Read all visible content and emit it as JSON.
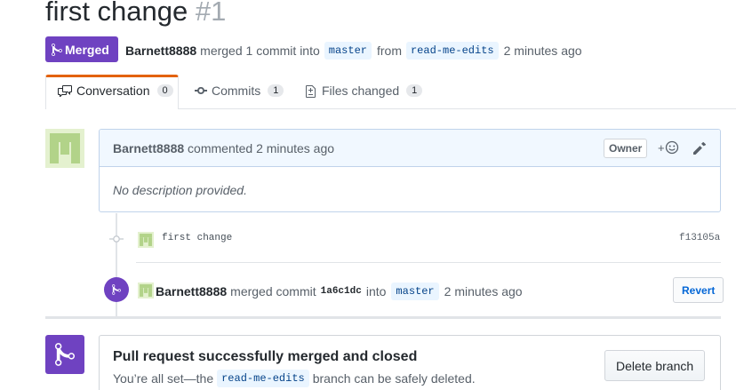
{
  "pr": {
    "title": "first change",
    "number": "#1",
    "state": "Merged",
    "author": "Barnett8888",
    "merged_text": "merged 1 commit into",
    "base_branch": "master",
    "from_text": "from",
    "head_branch": "read-me-edits",
    "time": "2 minutes ago"
  },
  "tabs": [
    {
      "label": "Conversation",
      "count": "0",
      "icon": "comment-discussion-icon"
    },
    {
      "label": "Commits",
      "count": "1",
      "icon": "git-commit-icon"
    },
    {
      "label": "Files changed",
      "count": "1",
      "icon": "file-diff-icon"
    }
  ],
  "comment": {
    "author": "Barnett8888",
    "action": "commented 2 minutes ago",
    "badge": "Owner",
    "reaction_label": "+",
    "body": "No description provided."
  },
  "commit": {
    "message": "first change",
    "sha": "f13105a"
  },
  "merge_event": {
    "author": "Barnett8888",
    "text": "merged commit",
    "sha": "1a6c1dc",
    "into": "into",
    "branch": "master",
    "time": "2 minutes ago",
    "revert_label": "Revert"
  },
  "merged_box": {
    "title": "Pull request successfully merged and closed",
    "desc_prefix": "You’re all set—the",
    "branch": "read-me-edits",
    "desc_suffix": "branch can be safely deleted.",
    "delete_label": "Delete branch"
  },
  "colors": {
    "merged_purple": "#6f42c1",
    "tab_accent": "#e36209",
    "link_blue": "#0366d6"
  }
}
